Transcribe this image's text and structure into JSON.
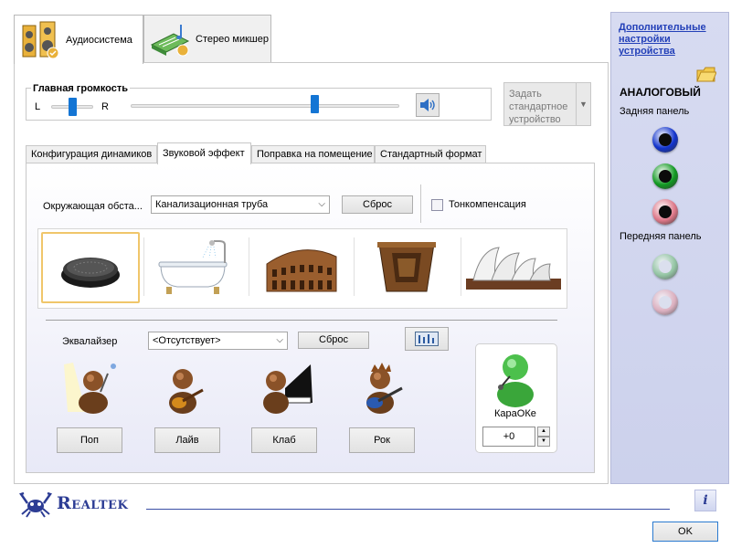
{
  "tabs": [
    {
      "label": "Аудиосистема",
      "active": true
    },
    {
      "label": "Стерео микшер",
      "active": false
    }
  ],
  "volume": {
    "title": "Главная громкость",
    "left_label": "L",
    "right_label": "R",
    "balance_level": 0.5,
    "master_level": 0.68
  },
  "default_device": {
    "label": "Задать стандартное устройство",
    "enabled": false
  },
  "sub_tabs": [
    {
      "label": "Конфигурация динамиков",
      "active": false
    },
    {
      "label": "Звуковой эффект",
      "active": true
    },
    {
      "label": "Поправка на помещение",
      "active": false
    },
    {
      "label": "Стандартный формат",
      "active": false
    }
  ],
  "environment": {
    "label": "Окружающая обста...",
    "selected": "Канализационная труба",
    "reset_label": "Сброс",
    "loudness_label": "Тонкомпенсация",
    "loudness_checked": false,
    "presets": [
      "sewer-pipe",
      "bathroom",
      "colosseum",
      "stone-corridor",
      "opera-house"
    ],
    "selected_preset": 0
  },
  "equalizer": {
    "label": "Эквалайзер",
    "selected": "<Отсутствует>",
    "reset_label": "Сброс",
    "presets": [
      "Поп",
      "Лайв",
      "Клаб",
      "Рок"
    ]
  },
  "karaoke": {
    "label": "КараОКе",
    "value": "+0"
  },
  "side_panel": {
    "link": "Дополнительные настройки устройства",
    "mode": "АНАЛОГОВЫЙ",
    "rear_panel": "Задняя панель",
    "front_panel": "Передняя панель",
    "rear_jacks": [
      {
        "name": "line-in",
        "color": "#1133cc",
        "active": true
      },
      {
        "name": "line-out",
        "color": "#119922",
        "active": true
      },
      {
        "name": "mic-in",
        "color": "#dd7788",
        "active": true
      }
    ],
    "front_jacks": [
      {
        "name": "headphone-out",
        "color": "#7fbf8a",
        "active": false
      },
      {
        "name": "mic-in-front",
        "color": "#e0a4b0",
        "active": false
      }
    ]
  },
  "brand": "Realtek",
  "ok_label": "OK",
  "colors": {
    "accent": "#1475d4",
    "brand": "#2c3c94",
    "link": "#2340b8"
  }
}
